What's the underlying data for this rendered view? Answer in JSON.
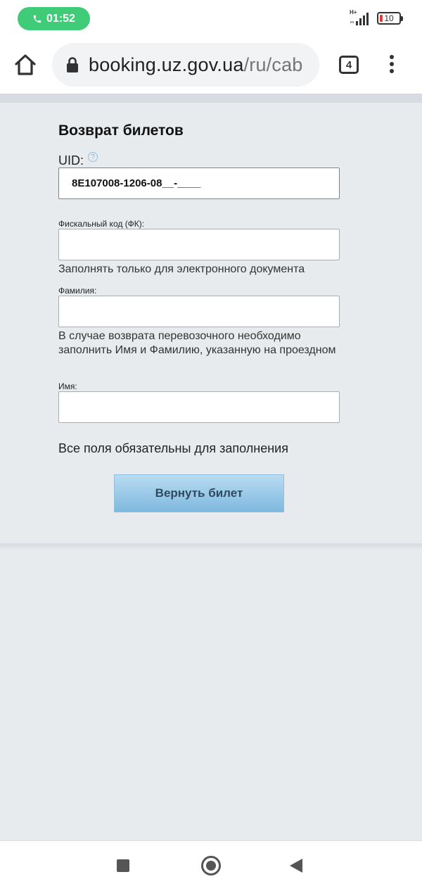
{
  "status_bar": {
    "time": "01:52",
    "network_type": "H+",
    "battery_level": "10"
  },
  "browser": {
    "url_domain": "booking.uz.gov.ua",
    "url_path": "/ru/cab",
    "tab_count": "4"
  },
  "form": {
    "title": "Возврат билетов",
    "uid_label": "UID:",
    "uid_value": "8E107008-1206-08__-____",
    "fiscal_label": "Фискальный код (ФК):",
    "fiscal_value": "",
    "fiscal_hint": "Заполнять только для электронного документа",
    "surname_label": "Фамилия:",
    "surname_value": "",
    "surname_hint": "В случае возврата перевозочного необходимо заполнить Имя и Фамилию, указанную на проездном",
    "name_label": "Имя:",
    "name_value": "",
    "required_note": "Все поля обязательны для заполнения",
    "submit_label": "Вернуть билет"
  },
  "colors": {
    "call_pill": "#3fcb77",
    "page_bg": "#e8ebee",
    "button_top": "#b8dcf2",
    "button_bottom": "#7fb8de",
    "battery_low": "#e53935"
  },
  "icons": {
    "call": "phone-icon",
    "home": "home-icon",
    "lock": "lock-icon",
    "menu": "more-vert-icon",
    "help": "help-icon"
  }
}
